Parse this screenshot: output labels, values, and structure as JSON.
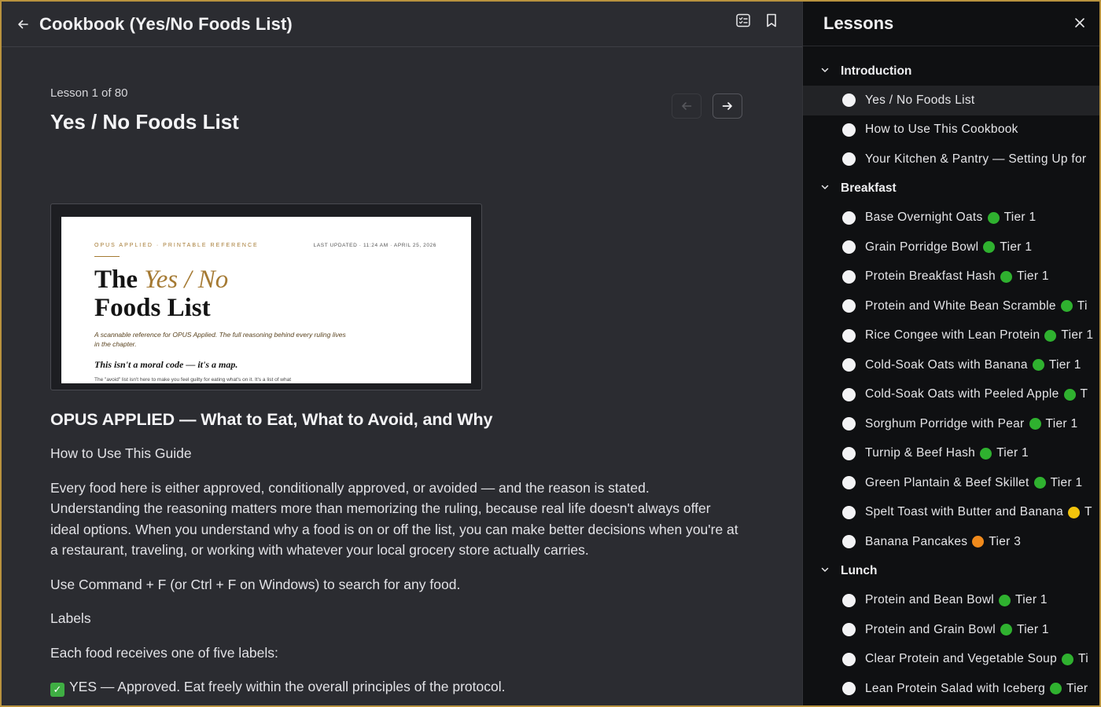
{
  "header": {
    "course_title": "Cookbook (Yes/No Foods List)"
  },
  "lesson": {
    "counter": "Lesson 1 of 80",
    "title": "Yes / No Foods List"
  },
  "preview": {
    "eyebrow": "OPUS APPLIED · PRINTABLE REFERENCE",
    "updated": "LAST UPDATED · 11:24 AM · APRIL 25, 2026",
    "title_the": "The",
    "title_accent": "Yes / No",
    "title_rest": "Foods List",
    "subtitle": "A scannable reference for OPUS Applied. The full reasoning behind every ruling lives in the chapter.",
    "tagline": "This isn't a moral code — it's a map.",
    "cut_line": "The \"avoid\" list isn't here to make you feel guilty for eating what's on it. It's a list of what"
  },
  "article": {
    "heading": "OPUS APPLIED — What to Eat, What to Avoid, and Why",
    "guide_label": "How to Use This Guide",
    "para1": "Every food here is either approved, conditionally approved, or avoided — and the reason is stated. Understanding the reasoning matters more than memorizing the ruling, because real life doesn't always offer ideal options. When you understand why a food is on or off the list, you can make better decisions when you're at a restaurant, traveling, or working with whatever your local grocery store actually carries.",
    "search_tip": "Use Command + F (or Ctrl + F on Windows) to search for any food.",
    "labels_heading": "Labels",
    "labels_intro": "Each food receives one of five labels:",
    "yes_label": "YES — Approved. Eat freely within the overall principles of the protocol."
  },
  "sidebar": {
    "title": "Lessons",
    "sections": [
      {
        "name": "Introduction",
        "lessons": [
          {
            "title": "Yes / No Foods List",
            "tier": "",
            "dot": "",
            "active": true
          },
          {
            "title": "How to Use This Cookbook",
            "tier": "",
            "dot": ""
          },
          {
            "title": "Your Kitchen & Pantry — Setting Up for",
            "tier": "",
            "dot": ""
          }
        ]
      },
      {
        "name": "Breakfast",
        "lessons": [
          {
            "title": "Base Overnight Oats",
            "tier": "Tier 1",
            "dot": "#2fb12f"
          },
          {
            "title": "Grain Porridge Bowl",
            "tier": "Tier 1",
            "dot": "#2fb12f"
          },
          {
            "title": "Protein Breakfast Hash",
            "tier": "Tier 1",
            "dot": "#2fb12f"
          },
          {
            "title": "Protein and White Bean Scramble",
            "tier": "Ti",
            "dot": "#2fb12f"
          },
          {
            "title": "Rice Congee with Lean Protein",
            "tier": "Tier 1",
            "dot": "#2fb12f"
          },
          {
            "title": "Cold-Soak Oats with Banana",
            "tier": "Tier 1",
            "dot": "#2fb12f"
          },
          {
            "title": "Cold-Soak Oats with Peeled Apple",
            "tier": "T",
            "dot": "#2fb12f"
          },
          {
            "title": "Sorghum Porridge with Pear",
            "tier": "Tier 1",
            "dot": "#2fb12f"
          },
          {
            "title": "Turnip & Beef Hash",
            "tier": "Tier 1",
            "dot": "#2fb12f"
          },
          {
            "title": "Green Plantain & Beef Skillet",
            "tier": "Tier 1",
            "dot": "#2fb12f"
          },
          {
            "title": "Spelt Toast with Butter and Banana",
            "tier": "T",
            "dot": "#f2c40c"
          },
          {
            "title": "Banana Pancakes",
            "tier": "Tier 3",
            "dot": "#f08a1c"
          }
        ]
      },
      {
        "name": "Lunch",
        "lessons": [
          {
            "title": "Protein and Bean Bowl",
            "tier": "Tier 1",
            "dot": "#2fb12f"
          },
          {
            "title": "Protein and Grain Bowl",
            "tier": "Tier 1",
            "dot": "#2fb12f"
          },
          {
            "title": "Clear Protein and Vegetable Soup",
            "tier": "Ti",
            "dot": "#2fb12f"
          },
          {
            "title": "Lean Protein Salad with Iceberg",
            "tier": "Tier",
            "dot": "#2fb12f"
          }
        ]
      }
    ]
  }
}
